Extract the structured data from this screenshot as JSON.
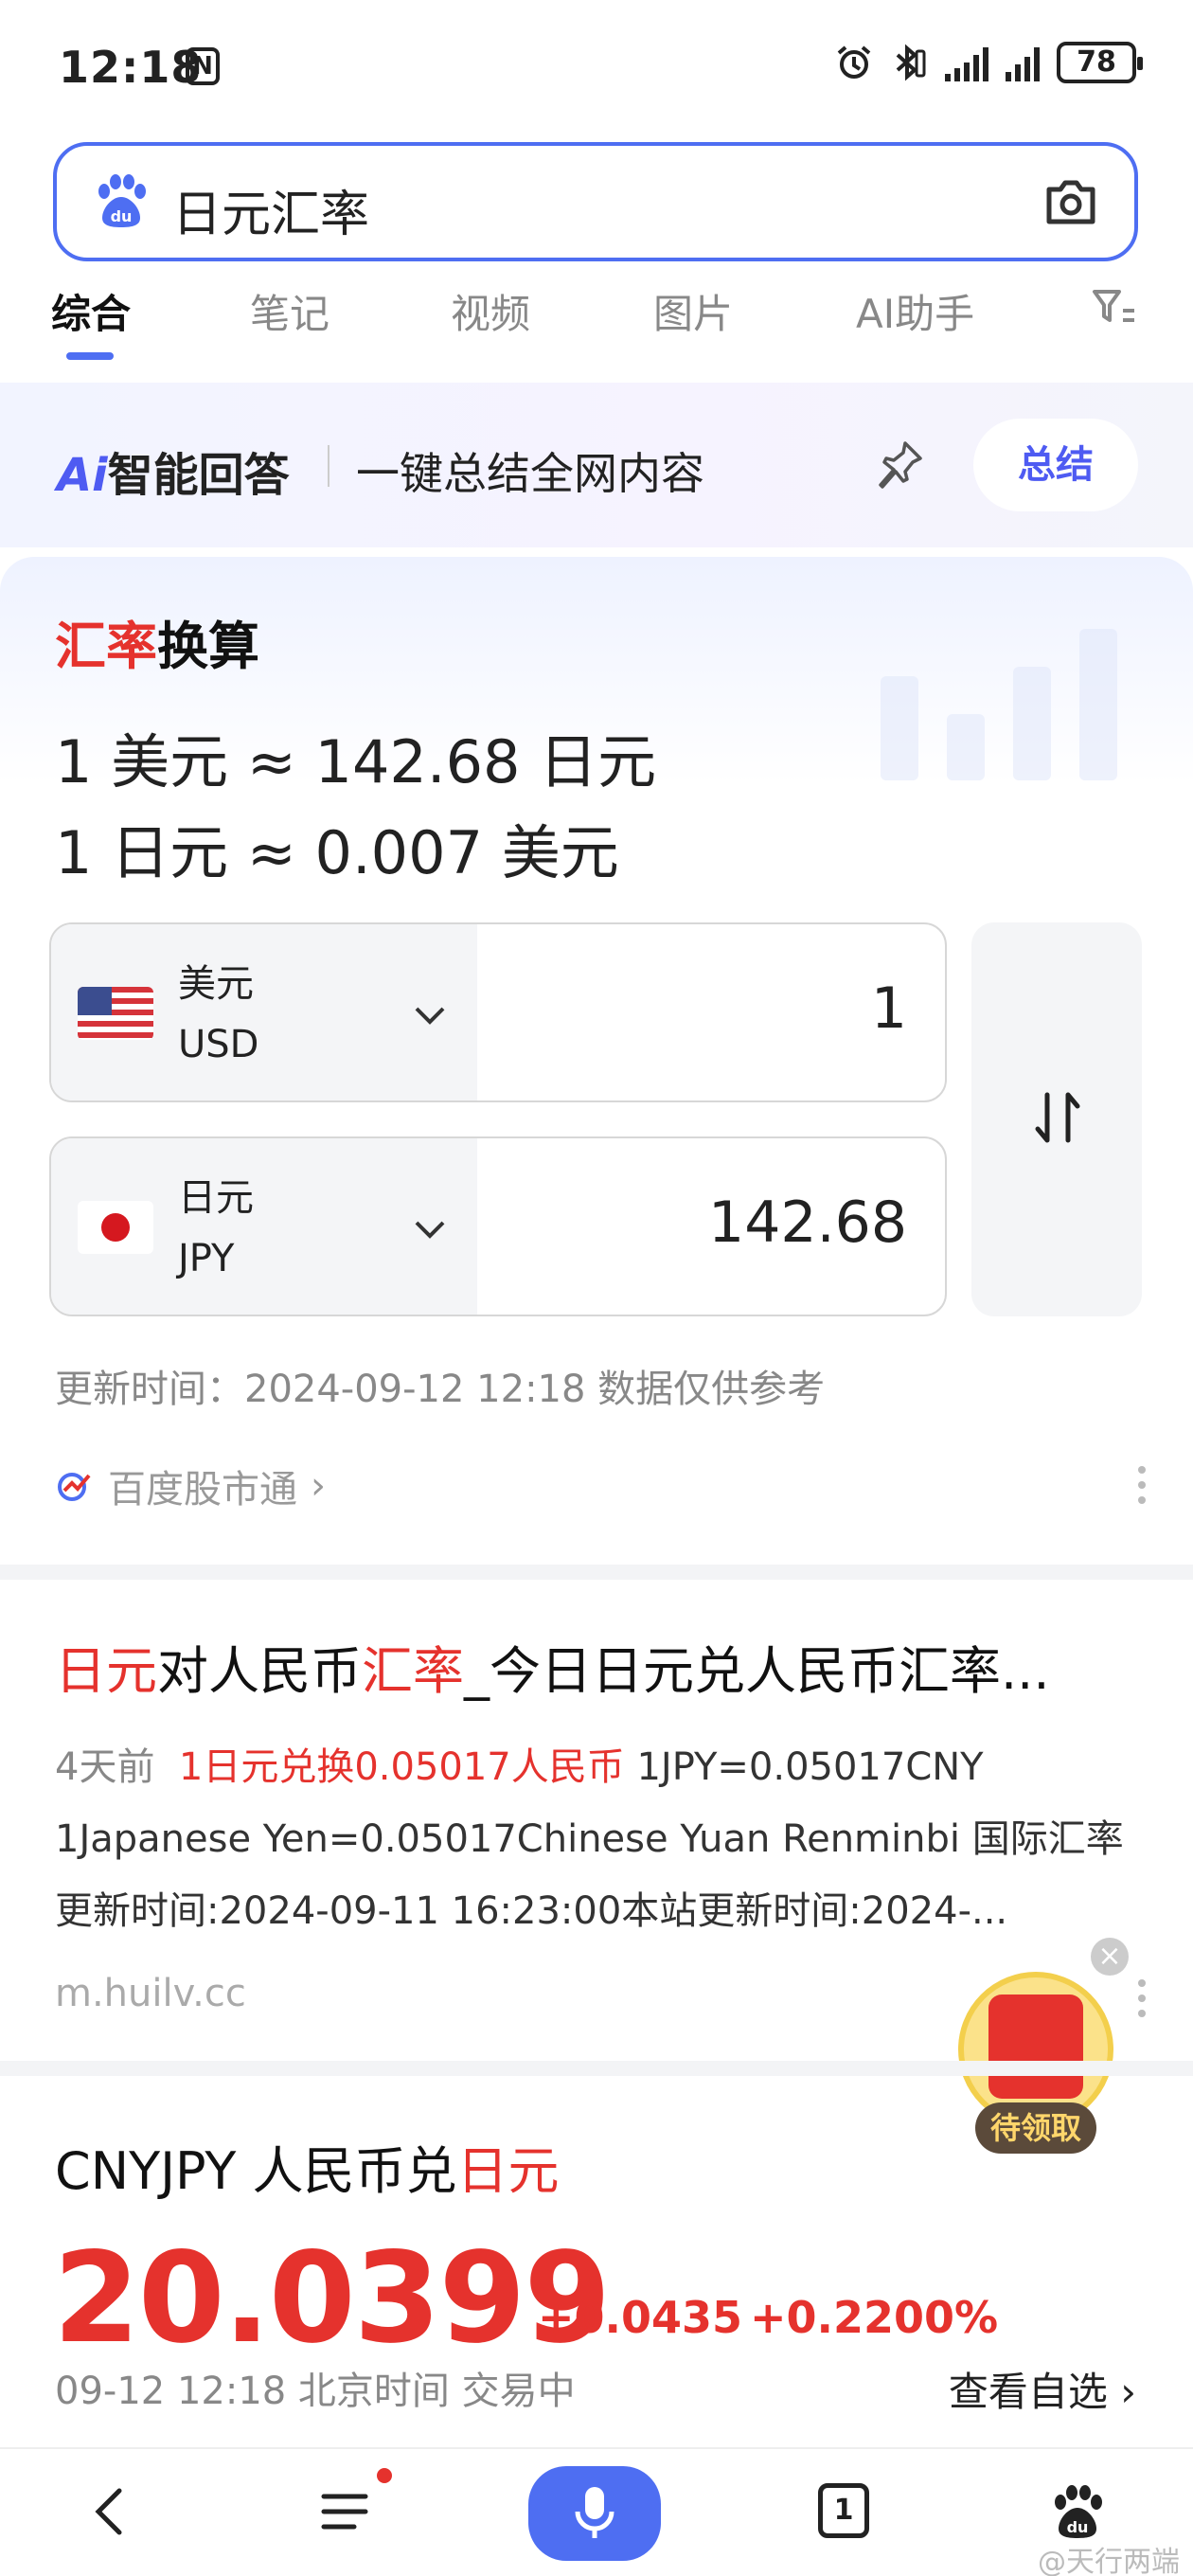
{
  "status_bar": {
    "time": "12:18",
    "nfc": "N",
    "battery": "78"
  },
  "search": {
    "query": "日元汇率"
  },
  "tabs": [
    {
      "label": "综合",
      "active": true
    },
    {
      "label": "笔记",
      "active": false
    },
    {
      "label": "视频",
      "active": false
    },
    {
      "label": "图片",
      "active": false
    },
    {
      "label": "AI助手",
      "active": false
    }
  ],
  "ai_banner": {
    "logo_ai": "Ai",
    "logo_text": "智能回答",
    "subtitle": "一键总结全网内容",
    "button": "总结"
  },
  "rate_card": {
    "title_highlight": "汇率",
    "title_rest": "换算",
    "line1": "1 美元 ≈ 142.68 日元",
    "line2": "1 日元 ≈ 0.007 美元",
    "from": {
      "name": "美元",
      "code": "USD",
      "value": "1"
    },
    "to": {
      "name": "日元",
      "code": "JPY",
      "value": "142.68"
    },
    "update": "更新时间：2024-09-12 12:18 数据仅供参考",
    "source": "百度股市通",
    "source_chevron": "›"
  },
  "result1": {
    "title_parts": [
      "日元",
      "对人民币",
      "汇率",
      "_今日日元兑人民币汇率..."
    ],
    "date": "4天前",
    "highlight": "1日元兑换0.05017人民币",
    "desc_rest": " 1JPY=0.05017CNY 1Japanese Yen=0.05017Chinese Yuan Renminbi 国际汇率更新时间:2024-09-11 16:23:00本站更新时间:2024-...",
    "url": "m.huilv.cc"
  },
  "envelope": {
    "label": "待领取",
    "close": "×"
  },
  "result2": {
    "title_prefix": "CNYJPY 人民币兑",
    "title_highlight": "日元",
    "price": "20.0399",
    "change_abs": "+0.0435",
    "change_pct": "+0.2200%",
    "meta": "09-12 12:18  北京时间  交易中",
    "watchlist": "查看自选 ›"
  },
  "bottom_nav": {
    "tab_count": "1"
  },
  "watermark": "@天行两端",
  "colors": {
    "accent": "#4e6ef2",
    "highlight_red": "#e5322d"
  }
}
